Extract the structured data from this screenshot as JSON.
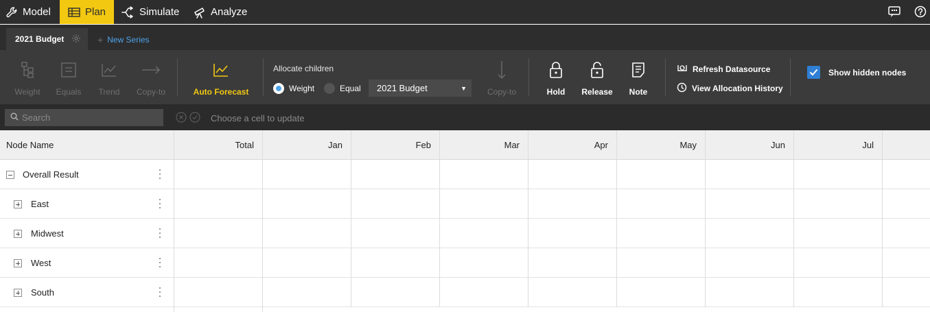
{
  "nav": {
    "model": "Model",
    "plan": "Plan",
    "simulate": "Simulate",
    "analyze": "Analyze"
  },
  "tabs": {
    "active": "2021 Budget",
    "new_series": "New Series"
  },
  "toolbar": {
    "weight": "Weight",
    "equals": "Equals",
    "trend": "Trend",
    "copy_to": "Copy-to",
    "auto_forecast": "Auto Forecast",
    "allocate_title": "Allocate children",
    "radio_weight": "Weight",
    "radio_equal": "Equal",
    "select_value": "2021 Budget",
    "copy_to_2": "Copy-to",
    "hold": "Hold",
    "release": "Release",
    "note": "Note",
    "refresh": "Refresh Datasource",
    "history": "View Allocation History",
    "show_hidden": "Show hidden nodes"
  },
  "search": {
    "placeholder": "Search",
    "status": "Choose a cell to update"
  },
  "grid": {
    "headers": {
      "node": "Node Name",
      "total": "Total",
      "months": [
        "Jan",
        "Feb",
        "Mar",
        "Apr",
        "May",
        "Jun",
        "Jul"
      ]
    },
    "rows": [
      {
        "label": "Overall Result",
        "expanded": true
      },
      {
        "label": "East",
        "expanded": false
      },
      {
        "label": "Midwest",
        "expanded": false
      },
      {
        "label": "West",
        "expanded": false
      },
      {
        "label": "South",
        "expanded": false
      }
    ]
  },
  "colors": {
    "accent": "#f2c811",
    "link": "#4ea2e8",
    "checkbox": "#2f7fd4",
    "toolbar_bg": "#3b3b3b",
    "topbar_bg": "#2d2d2d"
  }
}
